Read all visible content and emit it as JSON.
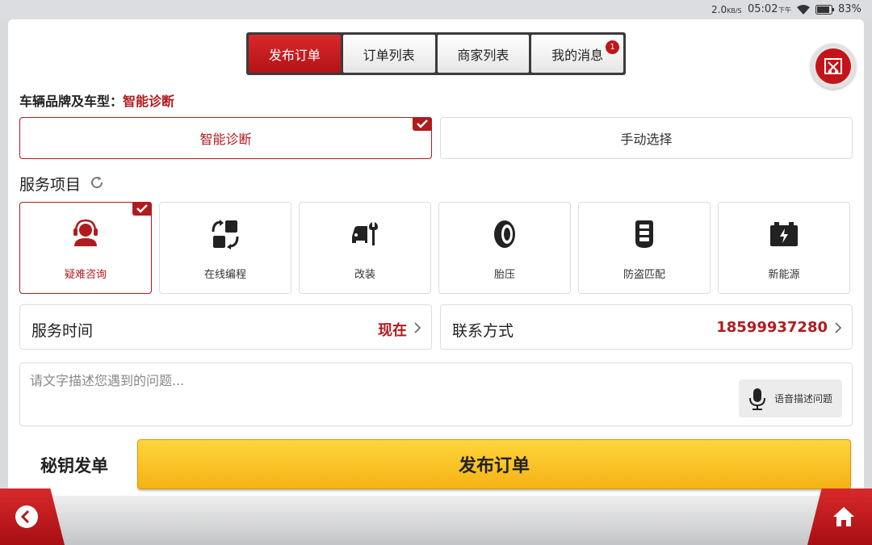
{
  "status": {
    "speed": "2.0",
    "speed_unit": "KB/S",
    "time": "05:02",
    "ampm": "下午",
    "battery": "83%"
  },
  "tabs": [
    {
      "label": "发布订单",
      "active": true
    },
    {
      "label": "订单列表",
      "active": false
    },
    {
      "label": "商家列表",
      "active": false
    },
    {
      "label": "我的消息",
      "active": false,
      "badge": "1"
    }
  ],
  "vehicle": {
    "label": "车辆品牌及车型：",
    "value": "智能诊断",
    "options": [
      {
        "label": "智能诊断",
        "selected": true
      },
      {
        "label": "手动选择",
        "selected": false
      }
    ]
  },
  "services": {
    "title": "服务项目",
    "items": [
      {
        "label": "疑难咨询",
        "icon": "consult-headset-icon",
        "selected": true
      },
      {
        "label": "在线编程",
        "icon": "online-programming-icon",
        "selected": false
      },
      {
        "label": "改装",
        "icon": "car-wrench-icon",
        "selected": false
      },
      {
        "label": "胎压",
        "icon": "tire-icon",
        "selected": false
      },
      {
        "label": "防盗匹配",
        "icon": "car-key-icon",
        "selected": false
      },
      {
        "label": "新能源",
        "icon": "battery-icon",
        "selected": false
      }
    ]
  },
  "service_time": {
    "label": "服务时间",
    "value": "现在"
  },
  "contact": {
    "label": "联系方式",
    "value": "18599937280"
  },
  "description": {
    "placeholder": "请文字描述您遇到的问题...",
    "voice_label": "语音描述问题"
  },
  "footer": {
    "secret_label": "秘钥发单",
    "submit_label": "发布订单"
  },
  "colors": {
    "accent": "#b01b1f",
    "submit": "#fcc62a"
  }
}
